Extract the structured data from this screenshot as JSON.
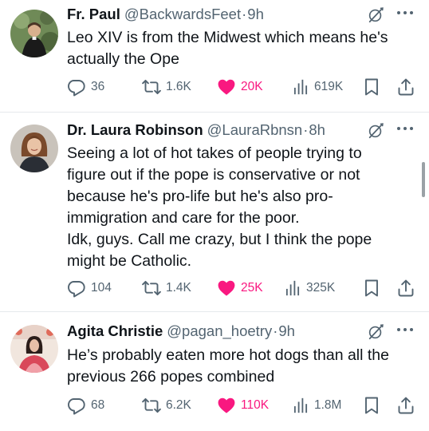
{
  "tweets": [
    {
      "name": "Fr. Paul",
      "handle": "@BackwardsFeet",
      "dot": "·",
      "time": "9h",
      "text": "Leo XIV is from the Midwest which means he's\nactually the Ope",
      "replies": "36",
      "retweets": "1.6K",
      "likes": "20K",
      "views": "619K"
    },
    {
      "name": "Dr. Laura Robinson",
      "handle": "@LauraRbnsn",
      "dot": "·",
      "time": "8h",
      "text": "Seeing a lot of hot takes of people trying to\nfigure out if the pope is conservative or not\nbecause he's pro-life but he's also pro-\nimmigration and care for the poor.\nIdk, guys. Call me crazy, but I think the pope\nmight be Catholic.",
      "replies": "104",
      "retweets": "1.4K",
      "likes": "25K",
      "views": "325K"
    },
    {
      "name": "Agita Christie",
      "handle": "@pagan_hoetry",
      "dot": "·",
      "time": "9h",
      "text": "He’s probably eaten more hot dogs than all the\nprevious 266 popes combined",
      "replies": "68",
      "retweets": "6.2K",
      "likes": "110K",
      "views": "1.8M"
    }
  ],
  "colors": {
    "like": "#f91880",
    "secondary_text": "#536471",
    "primary_text": "#0f1419",
    "divider": "#e6e9ec"
  },
  "icons": [
    "reply-icon",
    "retweet-icon",
    "heart-icon",
    "views-icon",
    "bookmark-icon",
    "share-icon",
    "grok-icon",
    "more-icon"
  ]
}
